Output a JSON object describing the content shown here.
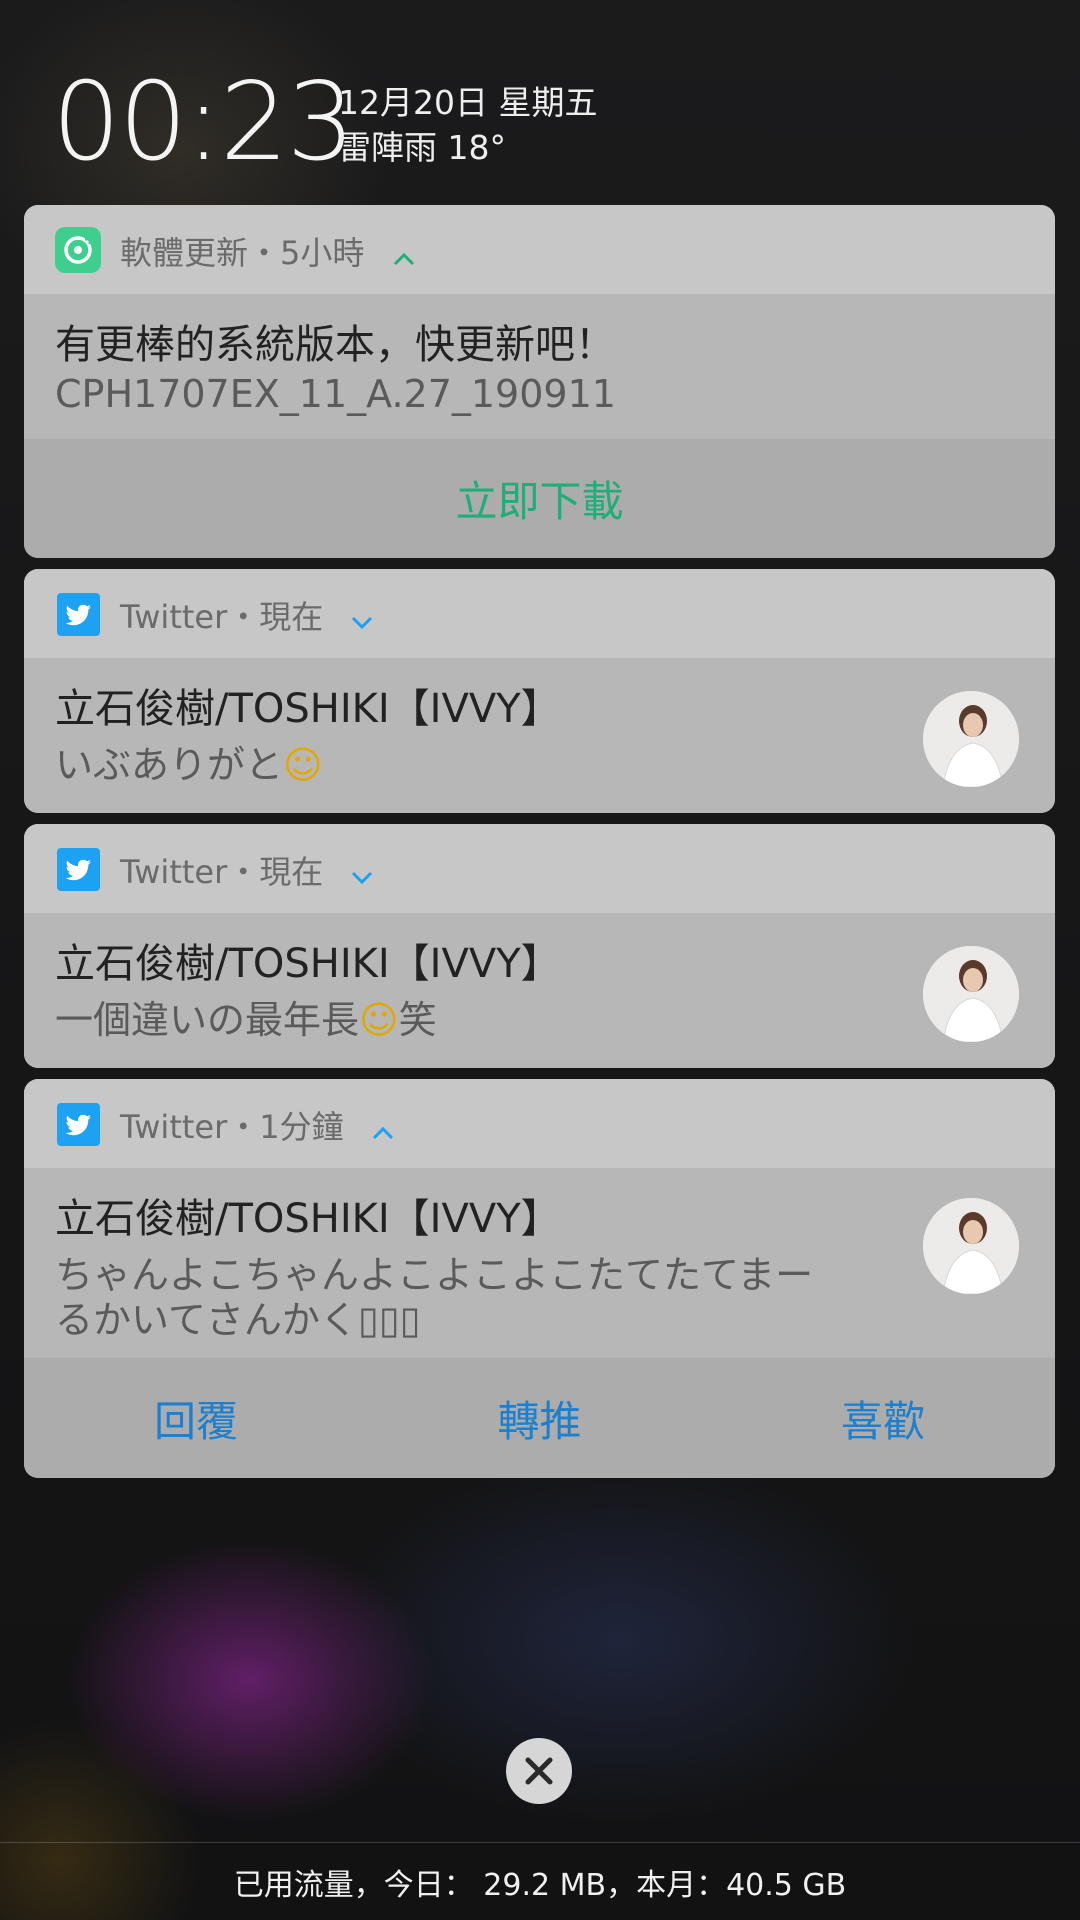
{
  "lockscreen": {
    "time": "00:23",
    "date": "12月20日 星期五",
    "weather": "雷陣雨 18°"
  },
  "notifications": [
    {
      "app": "軟體更新",
      "meta": "軟體更新・5小時",
      "title": "有更棒的系統版本，快更新吧！",
      "text": "CPH1707EX_11_A.27_190911",
      "action": "立即下載",
      "expanded": true,
      "accent": "#1fae7a"
    },
    {
      "app": "Twitter",
      "meta": "Twitter・現在",
      "title": "立石俊樹/TOSHIKI【IVVY】",
      "text": "いぶありがと",
      "emoji": "☺",
      "expanded": false,
      "accent": "#1da1f2"
    },
    {
      "app": "Twitter",
      "meta": "Twitter・現在",
      "title": "立石俊樹/TOSHIKI【IVVY】",
      "text_before": "一個違いの最年長",
      "emoji": "☺",
      "text_after": "笑",
      "expanded": false,
      "accent": "#1da1f2"
    },
    {
      "app": "Twitter",
      "meta": "Twitter・1分鐘",
      "title": "立石俊樹/TOSHIKI【IVVY】",
      "text_line1": "ちゃんよこちゃんよこよこよこたてたてまー",
      "text_line2": "るかいてさんかく▯▯▯",
      "expanded": true,
      "actions": [
        "回覆",
        "轉推",
        "喜歡"
      ],
      "accent": "#1c7fd0"
    }
  ],
  "footer": {
    "data_usage": "已用流量，今日： 29.2 MB，本月：40.5 GB"
  },
  "colors": {
    "update_green": "#1fae7a",
    "twitter_blue": "#1da1f2",
    "action_blue": "#1c7fd0"
  }
}
